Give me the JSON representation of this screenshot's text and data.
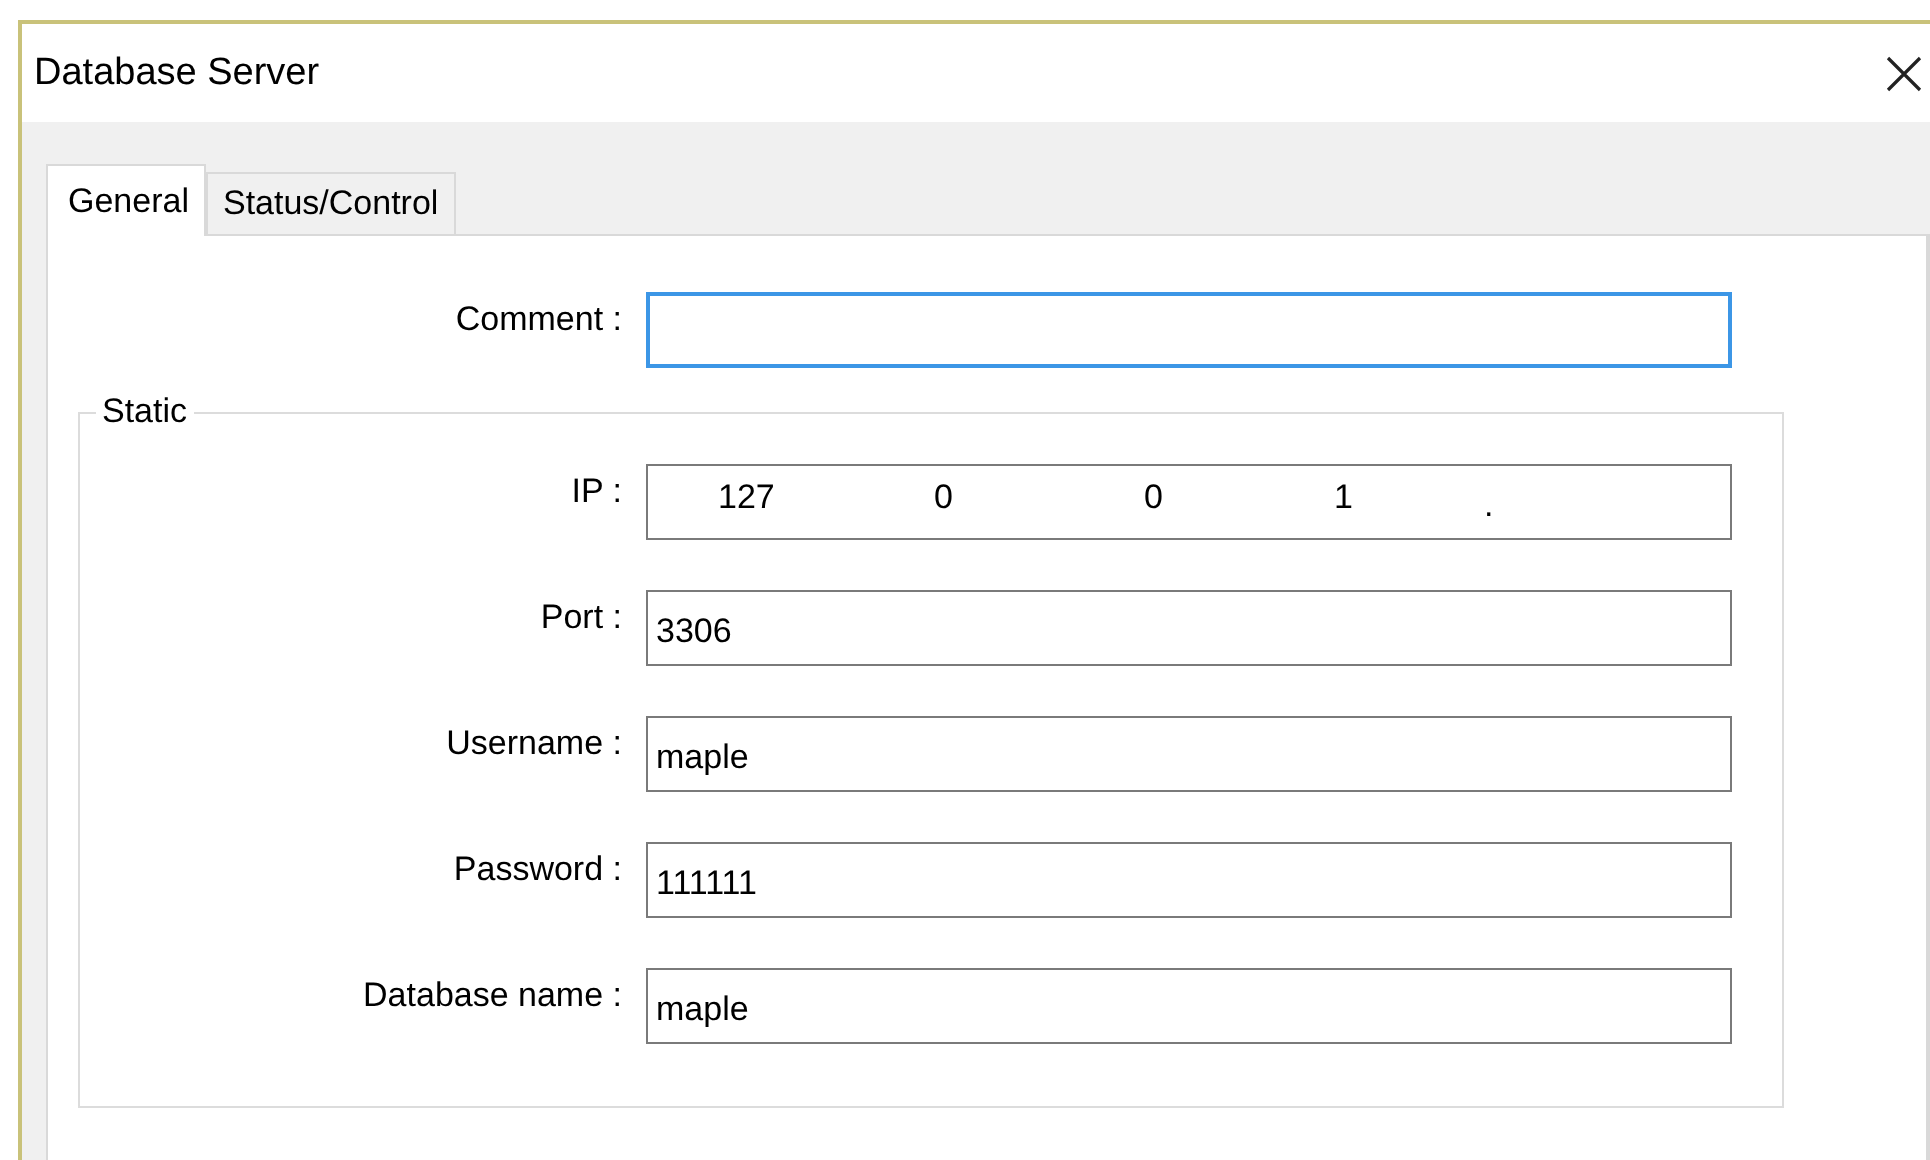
{
  "window": {
    "title": "Database Server"
  },
  "tabs": [
    {
      "label": "General",
      "selected": true
    },
    {
      "label": "Status/Control",
      "selected": false
    }
  ],
  "comment": {
    "label": "Comment :",
    "focused": true
  },
  "group": {
    "title": "Static",
    "fields": [
      {
        "kind": "ip",
        "label": "IP :",
        "octets": [
          "127",
          "0",
          "0",
          "1"
        ],
        "separator": "."
      },
      {
        "kind": "text",
        "label": "Port :",
        "value": "3306"
      },
      {
        "kind": "text",
        "label": "Username :",
        "value": "maple"
      },
      {
        "kind": "text",
        "label": "Password :",
        "value": "111111"
      },
      {
        "kind": "text",
        "label": "Database name :",
        "value": "maple"
      }
    ]
  }
}
